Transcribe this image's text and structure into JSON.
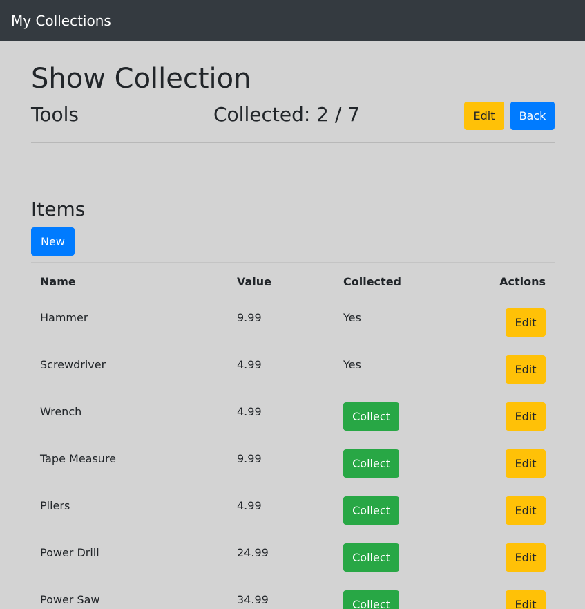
{
  "navbar": {
    "brand": "My Collections"
  },
  "page": {
    "title": "Show Collection"
  },
  "collection": {
    "name": "Tools",
    "collected_label": "Collected: 2 / 7",
    "edit_label": "Edit",
    "back_label": "Back"
  },
  "items_section": {
    "heading": "Items",
    "new_label": "New"
  },
  "table": {
    "headers": {
      "name": "Name",
      "value": "Value",
      "collected": "Collected",
      "actions": "Actions"
    },
    "collect_label": "Collect",
    "edit_label": "Edit",
    "rows": [
      {
        "name": "Hammer",
        "value": "9.99",
        "collected": "Yes"
      },
      {
        "name": "Screwdriver",
        "value": "4.99",
        "collected": "Yes"
      },
      {
        "name": "Wrench",
        "value": "4.99",
        "collected": ""
      },
      {
        "name": "Tape Measure",
        "value": "9.99",
        "collected": ""
      },
      {
        "name": "Pliers",
        "value": "4.99",
        "collected": ""
      },
      {
        "name": "Power Drill",
        "value": "24.99",
        "collected": ""
      },
      {
        "name": "Power Saw",
        "value": "34.99",
        "collected": ""
      }
    ]
  },
  "colors": {
    "navbar_bg": "#343a40",
    "page_bg": "#d3d3d3",
    "primary": "#007bff",
    "warning": "#ffc107",
    "success": "#28a745"
  }
}
